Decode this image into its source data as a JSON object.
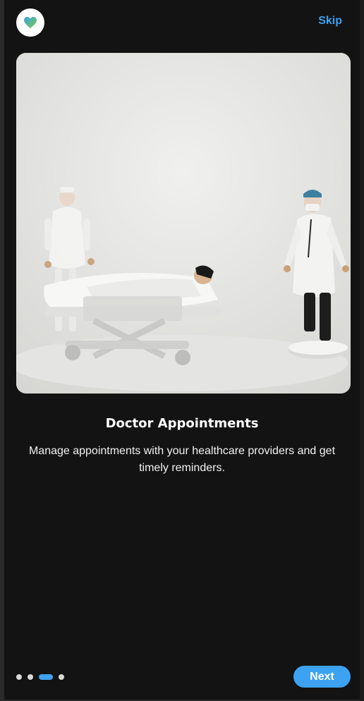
{
  "colors": {
    "accent": "#3da2f2",
    "background": "#131313",
    "logo_heart": "#3aa6ea",
    "logo_heart_accent": "#7ac943"
  },
  "header": {
    "logo_icon": "heart-icon",
    "skip_label": "Skip"
  },
  "hero": {
    "image_subject": "doctor-figurines-illustration"
  },
  "content": {
    "title": "Doctor Appointments",
    "description": "Manage appointments with your healthcare providers and get timely reminders."
  },
  "pagination": {
    "total": 4,
    "current": 3
  },
  "footer": {
    "next_label": "Next"
  }
}
